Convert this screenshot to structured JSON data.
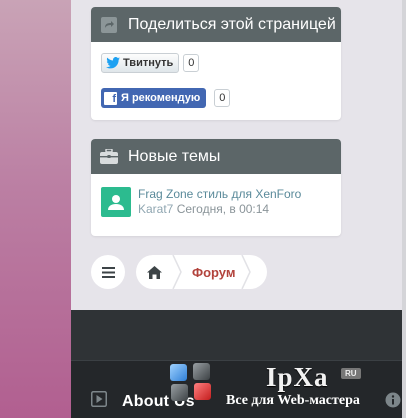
{
  "share": {
    "title": "Поделиться этой страницей",
    "tweet_label": "Твитнуть",
    "tweet_count": "0",
    "fb_label": "Я рекомендую",
    "fb_count": "0"
  },
  "new_threads": {
    "title": "Новые темы",
    "item": {
      "title": "Frag Zone стиль для XenForo",
      "author": "Karat7",
      "time": "Сегодня, в 00:14"
    }
  },
  "breadcrumb": {
    "forum": "Форум"
  },
  "footer": {
    "about": "About Us",
    "brand": "IpXa",
    "brand_badge": "RU",
    "brand_sub": "Все для Web-мастера"
  },
  "colors": {
    "widget_header": "#5c6668",
    "accent_red": "#b2433c",
    "avatar_green": "#2cbb8f",
    "facebook_blue": "#4267b2"
  },
  "icons": [
    "share-icon",
    "briefcase-icon",
    "twitter-bird-icon",
    "facebook-icon",
    "user-icon",
    "menu-icon",
    "home-icon",
    "play-icon",
    "info-icon"
  ]
}
